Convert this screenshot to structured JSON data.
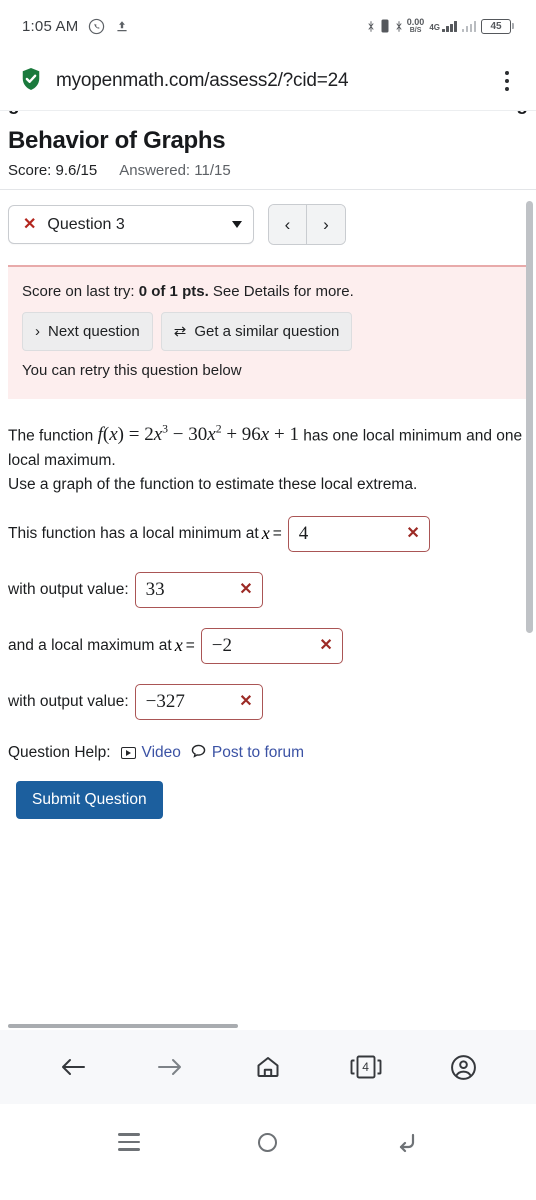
{
  "status_bar": {
    "time": "1:05 AM",
    "whatsapp_icon": "whatsapp-icon",
    "upload_icon": "upload-icon",
    "bluetooth_icon": "bluetooth-icon",
    "vibrate_icon": "vibrate-icon",
    "data_rate_value": "0.00",
    "data_rate_unit": "B/S",
    "network_type": "4G",
    "battery_percent": "45"
  },
  "browser": {
    "url": "myopenmath.com/assess2/?cid=24",
    "security_icon": "shield-check-icon",
    "menu_icon": "kebab-menu-icon",
    "toolbar": {
      "back": "back-arrow-icon",
      "forward": "forward-arrow-icon",
      "home": "home-icon",
      "tabs_count": "4",
      "profile": "profile-icon"
    }
  },
  "page": {
    "clipped_text_left": "g",
    "clipped_text_right": "g",
    "title": "Behavior of Graphs",
    "score_label": "Score: 9.6/15",
    "answered_label": "Answered: 11/15",
    "question_selector": {
      "status_icon": "x-mark-icon",
      "label": "Question 3",
      "dropdown_icon": "chevron-down-icon",
      "prev_icon": "‹",
      "next_icon": "›"
    },
    "alert": {
      "score_prefix": "Score on last try: ",
      "score_bold": "0 of 1 pts.",
      "score_suffix": " See Details for more.",
      "next_question_btn": "Next question",
      "next_question_icon": "›",
      "similar_question_btn": "Get a similar question",
      "similar_question_icon": "⇄",
      "trailing_text": "You can retry this question below"
    },
    "question": {
      "intro_pre": "The function ",
      "fn_name": "f",
      "fn_open": "(",
      "fn_var": "x",
      "fn_close": ")",
      "equals": "=",
      "term1_coef": "2",
      "term1_var": "x",
      "term1_exp": "3",
      "minus": "−",
      "term2_coef": "30",
      "term2_var": "x",
      "term2_exp": "2",
      "plus": "+",
      "term3_coef": "96",
      "term3_var": "x",
      "plus2": "+",
      "term4": "1",
      "intro_post": " has one local minimum and one local maximum.",
      "line2": "Use a graph of the function to estimate these local extrema."
    },
    "answers": [
      {
        "label": "This function has a local minimum at",
        "var": "x",
        "equals": "=",
        "value": "4",
        "mark": "✕",
        "width": "wide"
      },
      {
        "label": "with output value:",
        "var": "",
        "equals": "",
        "value": "33",
        "mark": "✕",
        "width": "narrow"
      },
      {
        "label": "and a local maximum at",
        "var": "x",
        "equals": "=",
        "value": "−2",
        "mark": "✕",
        "width": "wide"
      },
      {
        "label": "with output value:",
        "var": "",
        "equals": "",
        "value": "−327",
        "mark": "✕",
        "width": "narrow"
      }
    ],
    "help": {
      "label": "Question Help:",
      "video_link": "Video",
      "video_icon": "video-play-icon",
      "forum_link": "Post to forum",
      "forum_icon": "speech-bubble-icon"
    },
    "submit_label": "Submit Question"
  },
  "android_nav": {
    "recents_icon": "recents-icon",
    "home_icon": "home-circle-icon",
    "back_icon": "back-curve-icon"
  },
  "colors": {
    "submit_blue": "#1c5f9e",
    "alert_bg": "#fdeeee",
    "alert_border": "#e8aaaa",
    "field_border": "#a55555",
    "link_blue": "#3b52a4",
    "error_red": "#b3261e"
  }
}
